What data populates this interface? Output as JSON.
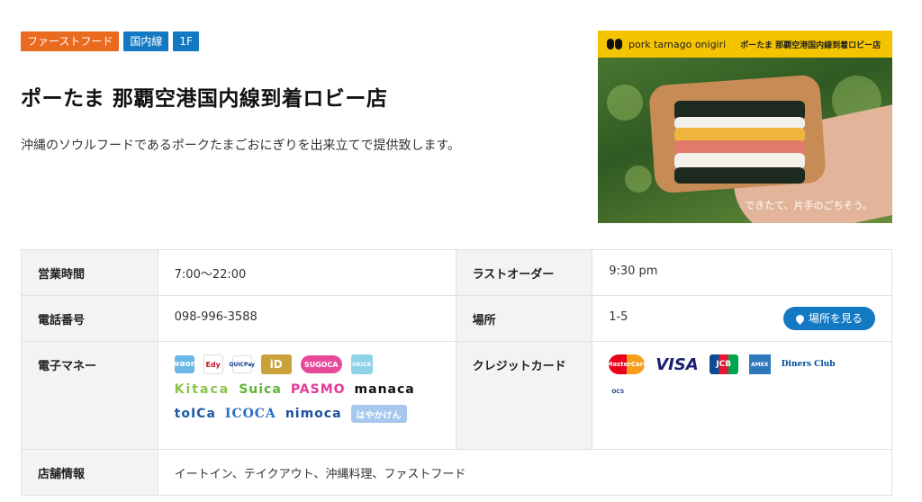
{
  "tags": [
    "ファーストフード",
    "国内線",
    "1F"
  ],
  "title": "ポーたま 那覇空港国内線到着ロビー店",
  "description": "沖縄のソウルフードであるポークたまごおにぎりを出来立てで提供致します。",
  "hero": {
    "brand": "pork tamago onigiri",
    "brand_jp": "ポーたま 那覇空港国内線到着ロビー店",
    "caption": "できたて、片手のごちそう。"
  },
  "info": {
    "hours_label": "営業時間",
    "hours_value": "7:00〜22:00",
    "last_order_label": "ラストオーダー",
    "last_order_value": "9:30 pm",
    "phone_label": "電話番号",
    "phone_value": "098-996-3588",
    "location_label": "場所",
    "location_value": "1-5",
    "map_button": "場所を見る",
    "emoney_label": "電子マネー",
    "credit_label": "クレジットカード",
    "store_label": "店舗情報",
    "store_value": "イートイン、テイクアウト、沖縄料理、ファストフード"
  },
  "emoney": {
    "row1": [
      "waon",
      "Edy",
      "QUICPay",
      "iD",
      "SUGOCA",
      "OKICA"
    ],
    "kitaca": "Kitaca",
    "suica": "Suica",
    "pasmo": "PASMO",
    "manaca": "manaca",
    "toica": "toICa",
    "icoca": "ICOCA",
    "nimoca": "nimoca",
    "hayakaken": "はやかけん"
  },
  "credit": {
    "mastercard": "MasterCard",
    "visa": "VISA",
    "jcb": "JCB",
    "amex": "AMEX",
    "diners": "Diners Club",
    "ocs": "OCS"
  },
  "colors": {
    "tag_orange": "#ea6a1f",
    "tag_blue": "#1479c3",
    "hero_band": "#f5c400"
  }
}
